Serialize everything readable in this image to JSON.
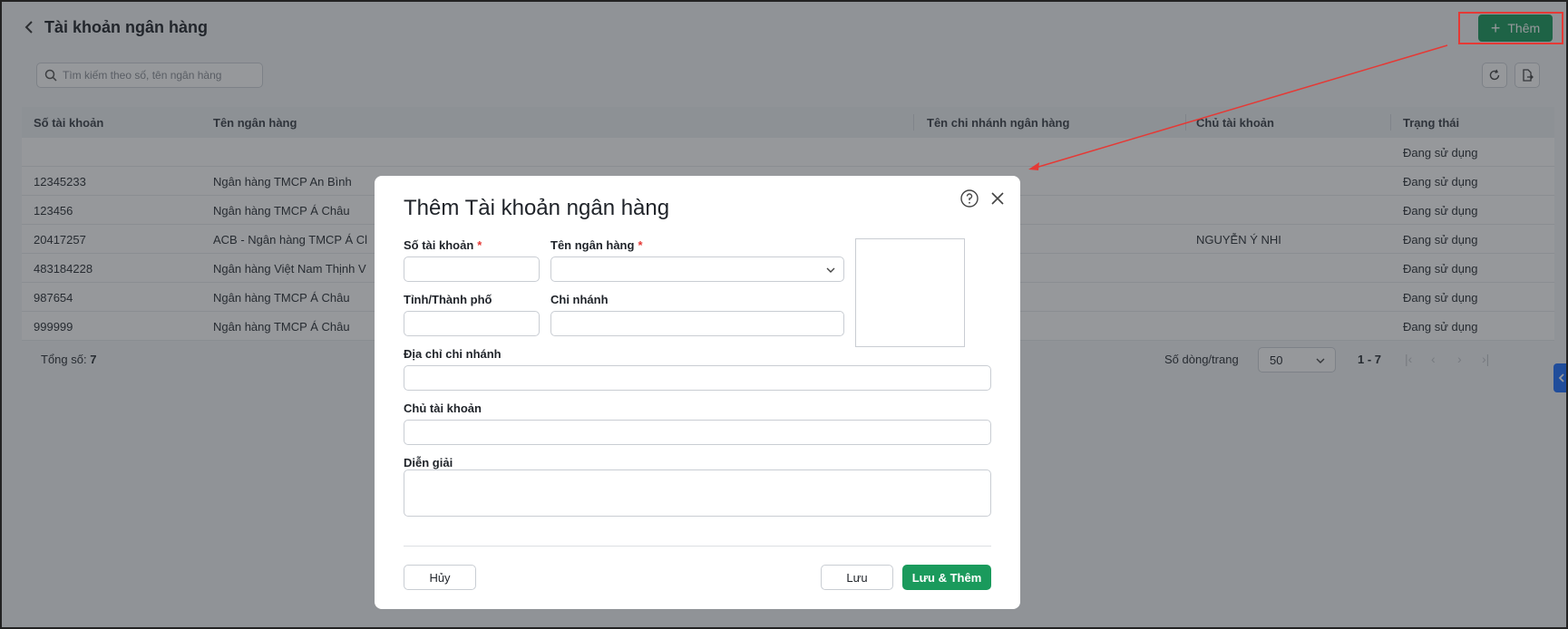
{
  "header": {
    "title": "Tài khoản ngân hàng",
    "add_label": "Thêm"
  },
  "toolbar": {
    "search_placeholder": "Tìm kiếm theo số, tên ngân hàng"
  },
  "table": {
    "columns": [
      "Số tài khoản",
      "Tên ngân hàng",
      "Tên chi nhánh ngân hàng",
      "Chủ tài khoản",
      "Trạng thái"
    ],
    "rows": [
      {
        "account": "",
        "bank": "",
        "branch": "",
        "owner": "",
        "status": "Đang sử dụng"
      },
      {
        "account": "12345233",
        "bank": "Ngân hàng TMCP An Bình",
        "branch": "",
        "owner": "",
        "status": "Đang sử dụng"
      },
      {
        "account": "123456",
        "bank": "Ngân hàng TMCP Á Châu",
        "branch": "",
        "owner": "",
        "status": "Đang sử dụng"
      },
      {
        "account": "20417257",
        "bank": "ACB - Ngân hàng TMCP Á Cl",
        "branch": "",
        "owner": "NGUYỄN Ý NHI",
        "status": "Đang sử dụng"
      },
      {
        "account": "483184228",
        "bank": "Ngân hàng Việt Nam Thịnh V",
        "branch": "",
        "owner": "",
        "status": "Đang sử dụng"
      },
      {
        "account": "987654",
        "bank": "Ngân hàng TMCP Á Châu",
        "branch": "",
        "owner": "",
        "status": "Đang sử dụng"
      },
      {
        "account": "999999",
        "bank": "Ngân hàng TMCP Á Châu",
        "branch": "",
        "owner": "",
        "status": "Đang sử dụng"
      }
    ]
  },
  "footer": {
    "total_label": "Tổng số:",
    "total_value": "7",
    "rows_per_page_label": "Số dòng/trang",
    "rows_per_page_value": "50",
    "range": "1 - 7"
  },
  "modal": {
    "title": "Thêm Tài khoản ngân hàng",
    "fields": {
      "account_number": "Số tài khoản",
      "bank_name": "Tên ngân hàng",
      "province": "Tỉnh/Thành phố",
      "branch": "Chi nhánh",
      "branch_address": "Địa chỉ chi nhánh",
      "owner": "Chủ tài khoản",
      "description": "Diễn giải",
      "required_mark": "*"
    },
    "buttons": {
      "cancel": "Hủy",
      "save": "Lưu",
      "save_and_add": "Lưu & Thêm"
    }
  },
  "colors": {
    "primary": "#1a9a5c",
    "annotation": "#e53935",
    "side_tab": "#1e6fff"
  }
}
